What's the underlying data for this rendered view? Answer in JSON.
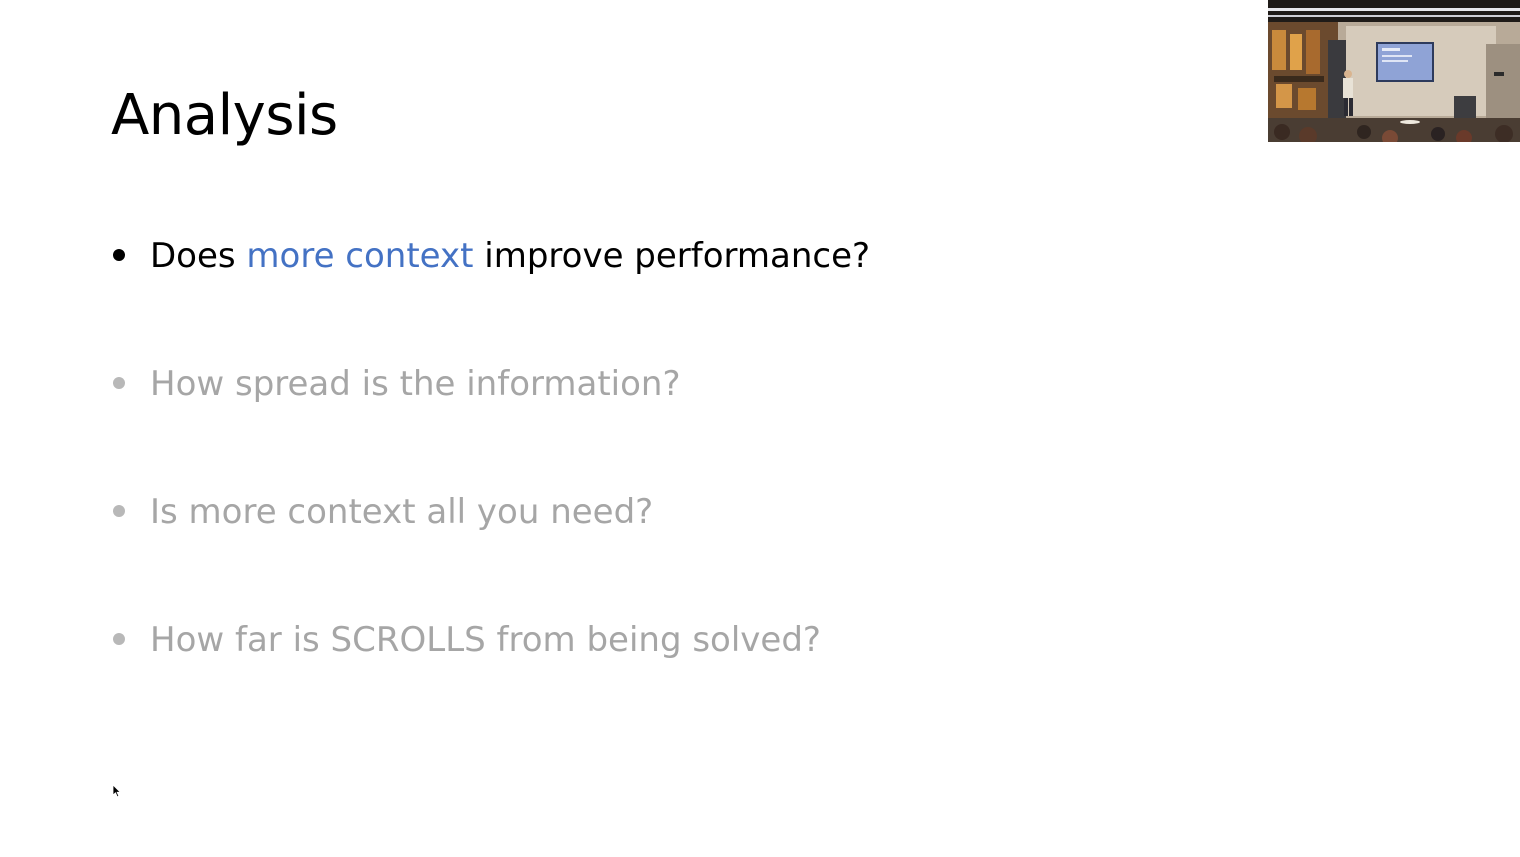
{
  "slide": {
    "title": "Analysis",
    "bullets": [
      {
        "before": "Does ",
        "highlight": "more context",
        "after": " improve performance?",
        "state": "active"
      },
      {
        "text": "How spread is the information?",
        "state": "dim"
      },
      {
        "text": "Is more context all you need?",
        "state": "dim"
      },
      {
        "text": "How far is SCROLLS from being solved?",
        "state": "dim"
      }
    ]
  },
  "colors": {
    "background": "#ffffff",
    "title_text": "#000000",
    "active_text": "#000000",
    "highlight_text": "#4472c4",
    "dimmed_text": "#a6a6a6"
  },
  "overlay": {
    "speaker_video": "speaker-camera-feed",
    "pointer": "mouse-cursor-icon"
  }
}
